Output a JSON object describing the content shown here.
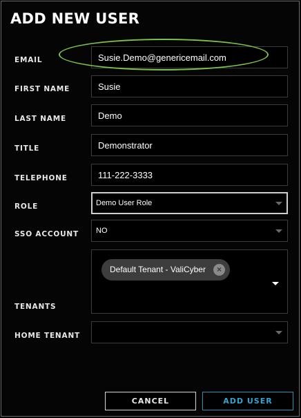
{
  "dialog": {
    "title": "ADD NEW USER"
  },
  "fields": {
    "email": {
      "label": "EMAIL",
      "value": "Susie.Demo@genericemail.com"
    },
    "first_name": {
      "label": "FIRST NAME",
      "value": "Susie"
    },
    "last_name": {
      "label": "LAST NAME",
      "value": "Demo"
    },
    "title": {
      "label": "TITLE",
      "value": "Demonstrator"
    },
    "telephone": {
      "label": "TELEPHONE",
      "value": "111-222-3333"
    },
    "role": {
      "label": "ROLE",
      "value": "Demo User Role"
    },
    "sso_account": {
      "label": "SSO ACCOUNT",
      "value": "NO"
    },
    "tenants": {
      "label": "TENANTS",
      "selected": [
        "Default Tenant - ValiCyber"
      ],
      "remove_glyph": "×"
    },
    "home_tenant": {
      "label": "HOME TENANT",
      "value": ""
    }
  },
  "buttons": {
    "cancel": "CANCEL",
    "add_user": "ADD USER"
  },
  "colors": {
    "highlight": "#7cc24a",
    "primary_accent": "#35a3cf"
  },
  "icons": {
    "dropdown": "chevron-down-icon",
    "remove": "remove-chip-icon"
  }
}
